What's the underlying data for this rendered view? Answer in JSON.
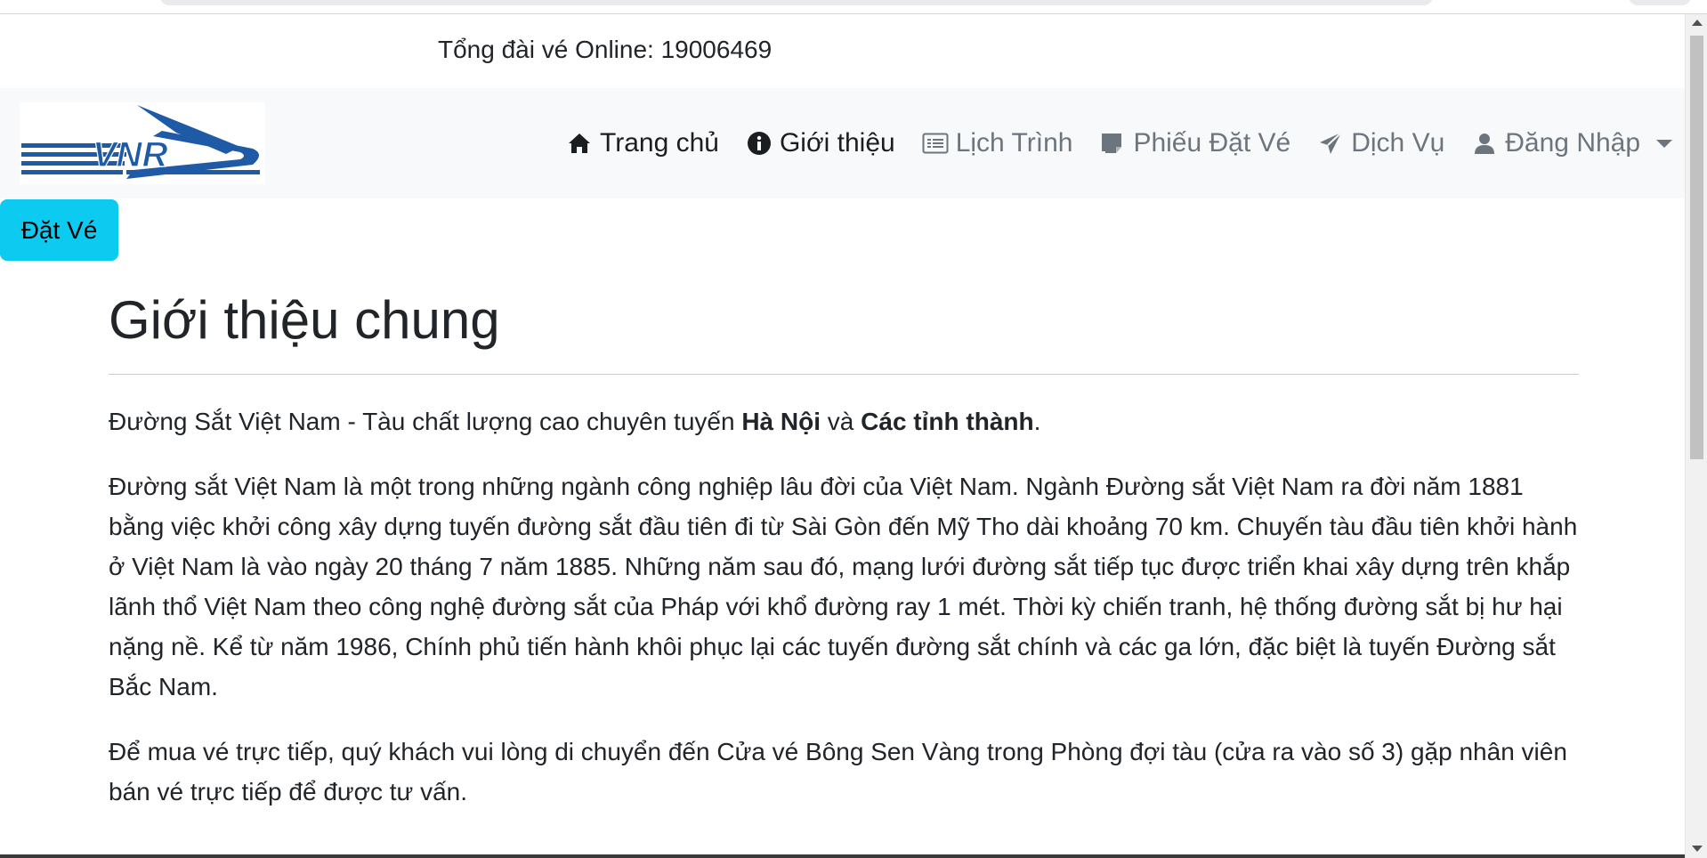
{
  "hotline": {
    "text": "Tổng đài vé Online: 19006469"
  },
  "brand": {
    "logo_text": "VNR",
    "logo_color": "#1f5aa6"
  },
  "nav": {
    "items": [
      {
        "label": "Trang chủ",
        "icon": "home-icon"
      },
      {
        "label": "Giới thiệu",
        "icon": "info-circle-icon"
      },
      {
        "label": "Lịch Trình",
        "icon": "list-card-icon"
      },
      {
        "label": "Phiếu Đặt Vé",
        "icon": "ticket-note-icon"
      },
      {
        "label": "Dịch Vụ",
        "icon": "paper-plane-icon"
      },
      {
        "label": "Đăng Nhập",
        "icon": "user-icon"
      }
    ]
  },
  "book_button": {
    "label": "Đặt Vé",
    "color": "#0dcaf0"
  },
  "content": {
    "title": "Giới thiệu chung",
    "lead": {
      "prefix": "Đường Sắt Việt Nam - Tàu chất lượng cao chuyên tuyến ",
      "bold1": "Hà Nội",
      "middle": " và ",
      "bold2": "Các tỉnh thành",
      "suffix": "."
    },
    "body": "Đường sắt Việt Nam là một trong những ngành công nghiệp lâu đời của Việt Nam. Ngành Đường sắt Việt Nam ra đời năm 1881 bằng việc khởi công xây dựng tuyến đường sắt đầu tiên đi từ Sài Gòn đến Mỹ Tho dài khoảng 70 km. Chuyến tàu đầu tiên khởi hành ở Việt Nam là vào ngày 20 tháng 7 năm 1885. Những năm sau đó, mạng lưới đường sắt tiếp tục được triển khai xây dựng trên khắp lãnh thổ Việt Nam theo công nghệ đường sắt của Pháp với khổ đường ray 1 mét. Thời kỳ chiến tranh, hệ thống đường sắt bị hư hại nặng nề. Kể từ năm 1986, Chính phủ tiến hành khôi phục lại các tuyến đường sắt chính và các ga lớn, đặc biệt là tuyến Đường sắt Bắc Nam.",
    "note": "Để mua vé trực tiếp, quý khách vui lòng di chuyển đến Cửa vé Bông Sen Vàng trong Phòng đợi tàu (cửa ra vào số 3) gặp nhân viên bán vé trực tiếp để được tư vấn."
  }
}
